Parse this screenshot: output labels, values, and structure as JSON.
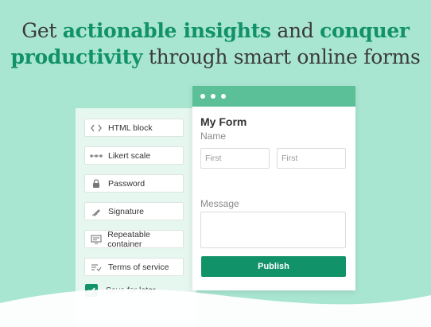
{
  "headline": {
    "line1_plain_a": "Get ",
    "line1_accent_a": "actionable insights",
    "line1_plain_b": " and ",
    "line1_accent_b": "conquer",
    "line2_accent": "productivity",
    "line2_plain": " through smart online forms"
  },
  "fields": [
    {
      "label": "HTML block",
      "icon": "code-icon"
    },
    {
      "label": "Likert scale",
      "icon": "likert-scale-icon"
    },
    {
      "label": "Password",
      "icon": "lock-icon"
    },
    {
      "label": "Signature",
      "icon": "pen-icon"
    },
    {
      "label": "Repeatable container",
      "icon": "repeat-container-icon"
    },
    {
      "label": "Terms of service",
      "icon": "terms-icon"
    }
  ],
  "save_later": {
    "label": "Save for later",
    "checked": true
  },
  "form": {
    "title": "My Form",
    "name_label": "Name",
    "first_placeholder_1": "First",
    "first_placeholder_2": "First",
    "message_label": "Message",
    "publish_label": "Publish"
  },
  "colors": {
    "background": "#a9e6d2",
    "accent": "#129268",
    "header": "#5bbf98",
    "panel": "#e6f7ef"
  }
}
